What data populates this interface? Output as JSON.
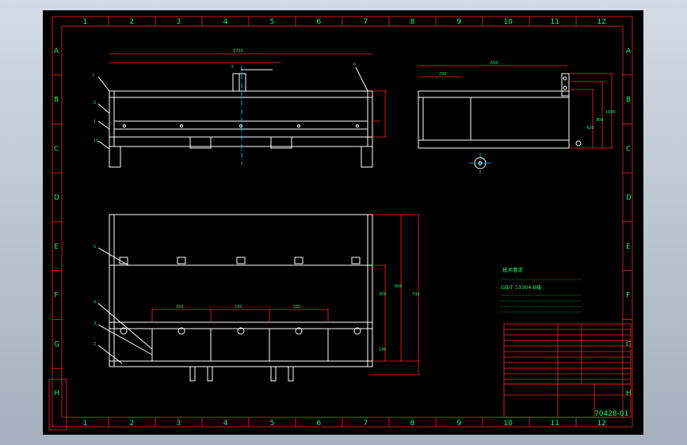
{
  "grid": {
    "columns": [
      "1",
      "2",
      "3",
      "4",
      "5",
      "6",
      "7",
      "8",
      "9",
      "10",
      "11",
      "12"
    ],
    "rows": [
      "A",
      "B",
      "C",
      "D",
      "E",
      "F",
      "G",
      "H"
    ]
  },
  "front_view": {
    "overall_width": "1720",
    "callouts": [
      "7",
      "5",
      "3",
      "6"
    ],
    "side_callouts": [
      "2",
      "1",
      "11"
    ]
  },
  "side_view": {
    "dims": [
      "650",
      "230",
      "420",
      "1000",
      "900"
    ]
  },
  "plan_view": {
    "side_callouts": [
      "5",
      "4",
      "3",
      "2"
    ],
    "dims_bottom": [
      "550",
      "550",
      "550"
    ],
    "dims_right": [
      "300",
      "600",
      "743",
      "140"
    ]
  },
  "notes": {
    "title": "技术要求",
    "line_std": "GB/T 13304-B级"
  },
  "title_block": {
    "drawing_no": "70428-01"
  }
}
